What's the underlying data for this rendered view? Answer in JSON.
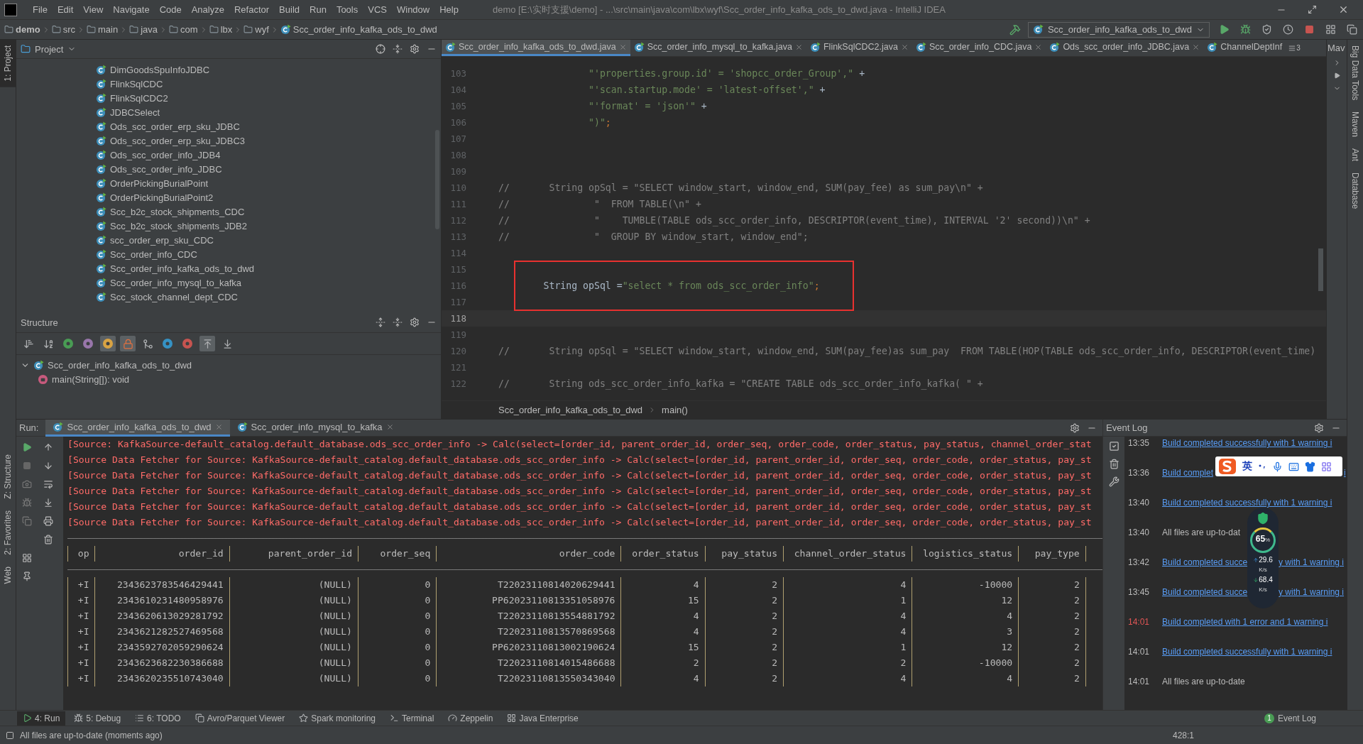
{
  "window": {
    "title": "demo [E:\\实时支援\\demo] - ...\\src\\main\\java\\com\\lbx\\wyf\\Scc_order_info_kafka_ods_to_dwd.java - IntelliJ IDEA"
  },
  "menu": [
    "File",
    "Edit",
    "View",
    "Navigate",
    "Code",
    "Analyze",
    "Refactor",
    "Build",
    "Run",
    "Tools",
    "VCS",
    "Window",
    "Help"
  ],
  "breadcrumbs": [
    "demo",
    "src",
    "main",
    "java",
    "com",
    "lbx",
    "wyf",
    "Scc_order_info_kafka_ods_to_dwd"
  ],
  "run_configuration": "Scc_order_info_kafka_ods_to_dwd",
  "left_stripe": [
    {
      "label": "1: Project",
      "selected": true,
      "docked_bottom": false
    },
    {
      "label": "Z: Structure",
      "selected": false,
      "docked_bottom": true
    },
    {
      "label": "2: Favorites",
      "selected": false,
      "docked_bottom": true
    },
    {
      "label": "Web",
      "selected": false,
      "docked_bottom": true
    }
  ],
  "project": {
    "title": "Project",
    "items": [
      "DimGoodsSpuInfoJDBC",
      "FlinkSqlCDC",
      "FlinkSqlCDC2",
      "JDBCSelect",
      "Ods_scc_order_erp_sku_JDBC",
      "Ods_scc_order_erp_sku_JDBC3",
      "Ods_scc_order_info_JDB4",
      "Ods_scc_order_info_JDBC",
      "OrderPickingBurialPoint",
      "OrderPickingBurialPoint2",
      "Scc_b2c_stock_shipments_CDC",
      "Scc_b2c_stock_shipments_JDB2",
      "scc_order_erp_sku_CDC",
      "Scc_order_info_CDC",
      "Scc_order_info_kafka_ods_to_dwd",
      "Scc_order_info_mysql_to_kafka",
      "Scc_stock_channel_dept_CDC"
    ]
  },
  "structure": {
    "title": "Structure",
    "toolbar": [
      {
        "kind": "visibility",
        "selected": false
      },
      {
        "kind": "alpha",
        "selected": false
      },
      {
        "kind": "inherited",
        "selected": false
      },
      {
        "kind": "property",
        "selected": false
      },
      {
        "kind": "field",
        "selected": true
      },
      {
        "kind": "private",
        "selected": true
      },
      {
        "kind": "anonymous",
        "selected": false
      },
      {
        "kind": "lambda-circle",
        "selected": false
      },
      {
        "kind": "lambda",
        "selected": false
      },
      {
        "kind": "autoscroll-to",
        "selected": true
      },
      {
        "kind": "autoscroll-from",
        "selected": false
      }
    ],
    "tree": [
      {
        "label": "Scc_order_info_kafka_ods_to_dwd",
        "kind": "class",
        "expanded": true,
        "children": [
          {
            "label": "main(String[]): void",
            "kind": "method"
          }
        ]
      }
    ]
  },
  "editor": {
    "tabs": [
      {
        "label": "Scc_order_info_kafka_ods_to_dwd.java",
        "selected": true
      },
      {
        "label": "Scc_order_info_mysql_to_kafka.java",
        "selected": false
      },
      {
        "label": "FlinkSqlCDC2.java",
        "selected": false
      },
      {
        "label": "Scc_order_info_CDC.java",
        "selected": false
      },
      {
        "label": "Ods_scc_order_info_JDBC.java",
        "selected": false
      },
      {
        "label": "ChannelDeptInf",
        "selected": false
      }
    ],
    "overflow_count": "3",
    "lines": [
      {
        "number": "103",
        "current": false,
        "boxed": false,
        "segments": [
          {
            "text": "                \"'properties.group.id' = 'shopcc_order_Group',\"",
            "kind": "string"
          },
          {
            "text": " +",
            "kind": "plain"
          }
        ]
      },
      {
        "number": "104",
        "current": false,
        "boxed": false,
        "segments": [
          {
            "text": "                \"'scan.startup.mode' = 'latest-offset',\"",
            "kind": "string"
          },
          {
            "text": " +",
            "kind": "plain"
          }
        ]
      },
      {
        "number": "105",
        "current": false,
        "boxed": false,
        "segments": [
          {
            "text": "                \"'format' = 'json'\"",
            "kind": "string"
          },
          {
            "text": " +",
            "kind": "plain"
          }
        ]
      },
      {
        "number": "106",
        "current": false,
        "boxed": false,
        "segments": [
          {
            "text": "                \")\"",
            "kind": "string"
          },
          {
            "text": ";",
            "kind": "keyword"
          }
        ]
      },
      {
        "number": "107",
        "current": false,
        "boxed": false
      },
      {
        "number": "108",
        "current": false,
        "boxed": false
      },
      {
        "number": "109",
        "current": false,
        "boxed": false
      },
      {
        "number": "110",
        "current": false,
        "boxed": false,
        "segments": [
          {
            "text": "//       String opSql = \"SELECT window_start, window_end, SUM(pay_fee) as sum_pay\\n\" +",
            "kind": "comment"
          }
        ]
      },
      {
        "number": "111",
        "current": false,
        "boxed": false,
        "segments": [
          {
            "text": "//               \"  FROM TABLE(\\n\" +",
            "kind": "comment"
          }
        ]
      },
      {
        "number": "112",
        "current": false,
        "boxed": false,
        "segments": [
          {
            "text": "//               \"    TUMBLE(TABLE ods_scc_order_info, DESCRIPTOR(event_time), INTERVAL '2' second))\\n\" +",
            "kind": "comment"
          }
        ]
      },
      {
        "number": "113",
        "current": false,
        "boxed": false,
        "segments": [
          {
            "text": "//               \"  GROUP BY window_start, window_end\";",
            "kind": "comment"
          }
        ]
      },
      {
        "number": "114",
        "current": false,
        "boxed": false
      },
      {
        "number": "115",
        "current": false,
        "boxed": true
      },
      {
        "number": "116",
        "current": false,
        "boxed": true,
        "segments": [
          {
            "text": "        String opSql =",
            "kind": "plain"
          },
          {
            "text": "\"select * from ods_scc_order_info\"",
            "kind": "string"
          },
          {
            "text": ";",
            "kind": "keyword"
          }
        ]
      },
      {
        "number": "117",
        "current": false,
        "boxed": true
      },
      {
        "number": "118",
        "current": true,
        "boxed": false
      },
      {
        "number": "119",
        "current": false,
        "boxed": false
      },
      {
        "number": "120",
        "current": false,
        "boxed": false,
        "segments": [
          {
            "text": "//       String opSql = \"SELECT window_start, window_end, SUM(pay_fee)as sum_pay  FROM TABLE(HOP(TABLE ods_scc_order_info, DESCRIPTOR(event_time)",
            "kind": "comment"
          }
        ]
      },
      {
        "number": "121",
        "current": false,
        "boxed": false
      },
      {
        "number": "122",
        "current": false,
        "boxed": false,
        "segments": [
          {
            "text": "//       String ods_scc_order_info_kafka = \"CREATE TABLE ods_scc_order_info_kafka( \" +",
            "kind": "comment"
          }
        ]
      }
    ],
    "breadcrumb": [
      "Scc_order_info_kafka_ods_to_dwd",
      "main()"
    ]
  },
  "maven_panel": {
    "title": "Mav"
  },
  "right_stripe": [
    "Big Data Tools",
    "Maven",
    "Ant",
    "Database"
  ],
  "run": {
    "title": "Run:",
    "tabs": [
      {
        "label": "Scc_order_info_kafka_ods_to_dwd",
        "selected": true
      },
      {
        "label": "Scc_order_info_mysql_to_kafka",
        "selected": false
      }
    ],
    "log": [
      {
        "text": "[Source: KafkaSource-default_catalog.default_database.ods_scc_order_info -> Calc(select=[order_id, parent_order_id, order_seq, order_code, order_status, pay_status, channel_order_stat",
        "kind": "error"
      },
      {
        "text": "[Source Data Fetcher for Source: KafkaSource-default_catalog.default_database.ods_scc_order_info -> Calc(select=[order_id, parent_order_id, order_seq, order_code, order_status, pay_st",
        "kind": "error"
      },
      {
        "text": "[Source Data Fetcher for Source: KafkaSource-default_catalog.default_database.ods_scc_order_info -> Calc(select=[order_id, parent_order_id, order_seq, order_code, order_status, pay_st",
        "kind": "error"
      },
      {
        "text": "[Source Data Fetcher for Source: KafkaSource-default_catalog.default_database.ods_scc_order_info -> Calc(select=[order_id, parent_order_id, order_seq, order_code, order_status, pay_st",
        "kind": "error"
      },
      {
        "text": "[Source Data Fetcher for Source: KafkaSource-default_catalog.default_database.ods_scc_order_info -> Calc(select=[order_id, parent_order_id, order_seq, order_code, order_status, pay_st",
        "kind": "error"
      },
      {
        "text": "[Source Data Fetcher for Source: KafkaSource-default_catalog.default_database.ods_scc_order_info -> Calc(select=[order_id, parent_order_id, order_seq, order_code, order_status, pay_st",
        "kind": "error"
      }
    ],
    "table": {
      "columns": [
        "op",
        "order_id",
        "parent_order_id",
        "order_seq",
        "order_code",
        "order_status",
        "pay_status",
        "channel_order_status",
        "logistics_status",
        "pay_type"
      ],
      "rows": [
        [
          "+I",
          "2343623783546429441",
          "(NULL)",
          "0",
          "T22023110814020629441",
          "4",
          "2",
          "4",
          "-10000",
          "2"
        ],
        [
          "+I",
          "2343610231480958976",
          "(NULL)",
          "0",
          "PP62023110813351058976",
          "15",
          "2",
          "1",
          "12",
          "2"
        ],
        [
          "+I",
          "2343620613029281792",
          "(NULL)",
          "0",
          "T22023110813554881792",
          "4",
          "2",
          "4",
          "4",
          "2"
        ],
        [
          "+I",
          "2343621282527469568",
          "(NULL)",
          "0",
          "T22023110813570869568",
          "4",
          "2",
          "4",
          "3",
          "2"
        ],
        [
          "+I",
          "2343592702059290624",
          "(NULL)",
          "0",
          "PP62023110813002190624",
          "15",
          "2",
          "1",
          "12",
          "2"
        ],
        [
          "+I",
          "2343623682230386688",
          "(NULL)",
          "0",
          "T22023110814015486688",
          "2",
          "2",
          "2",
          "-10000",
          "2"
        ],
        [
          "+I",
          "2343620235510743040",
          "(NULL)",
          "0",
          "T22023110813550343040",
          "4",
          "2",
          "4",
          "4",
          "2"
        ]
      ]
    }
  },
  "event_log": {
    "title": "Event Log",
    "entries": [
      {
        "time": "13:35",
        "message": "Build completed successfully with 1 warning i",
        "kind": "link",
        "error": false
      },
      {
        "time": "13:36",
        "message": "Build complet",
        "tail": "i",
        "widget_gap": false,
        "kind": "link",
        "error": false
      },
      {
        "time": "13:40",
        "message": "Build completed successfully with 1 warning i",
        "kind": "link",
        "error": false
      },
      {
        "time": "13:40",
        "message": "All files are up-to-dat",
        "kind": "text",
        "error": false
      },
      {
        "time": "13:42",
        "message": "Build completed succe",
        "tail": "y with 1 warning i",
        "widget_gap": true,
        "kind": "link",
        "error": false
      },
      {
        "time": "13:45",
        "message": "Build completed succe",
        "tail": "y with 1 warning i",
        "widget_gap": true,
        "kind": "link",
        "error": false
      },
      {
        "time": "14:01",
        "message": "Build completed with 1 error and 1 warning i",
        "kind": "link",
        "error": true
      },
      {
        "time": "14:01",
        "message": "Build completed successfully with 1 warning i",
        "kind": "link",
        "error": false
      },
      {
        "time": "14:01",
        "message": "All files are up-to-date",
        "kind": "text",
        "error": false
      }
    ]
  },
  "ime_bar": {
    "label": "英"
  },
  "speed_widget": {
    "percent": "65",
    "percent_unit": "%",
    "upload": "29.6",
    "upload_unit": "K/s",
    "download": "68.4",
    "download_unit": "K/s"
  },
  "tool_tabs": [
    {
      "label": "4: Run",
      "kind": "run",
      "selected": true
    },
    {
      "label": "5: Debug",
      "kind": "debug",
      "selected": false
    },
    {
      "label": "6: TODO",
      "kind": "todo",
      "selected": false
    },
    {
      "label": "Avro/Parquet Viewer",
      "kind": "viewer",
      "selected": false
    },
    {
      "label": "Spark monitoring",
      "kind": "spark",
      "selected": false
    },
    {
      "label": "Terminal",
      "kind": "terminal",
      "selected": false
    },
    {
      "label": "Zeppelin",
      "kind": "zeppelin",
      "selected": false
    },
    {
      "label": "Java Enterprise",
      "kind": "enterprise",
      "selected": false
    }
  ],
  "event_log_button": {
    "count": "1",
    "label": "Event Log"
  },
  "status_bar": {
    "message": "All files are up-to-date (moments ago)",
    "position": "428:1"
  }
}
